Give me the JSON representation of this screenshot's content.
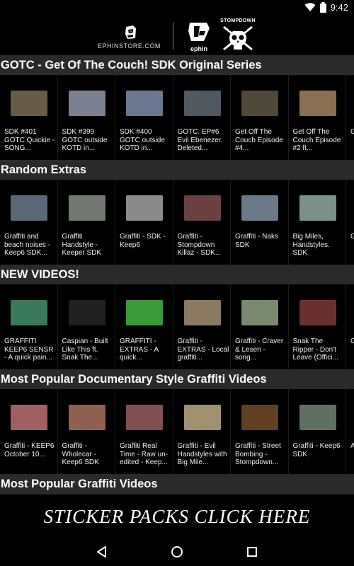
{
  "status": {
    "time": "9:42"
  },
  "header": {
    "store_logo_text": "EPHINSTORE.COM",
    "ephin_logo_text": "ephin",
    "stompdown_logo_text": "STOMPDOWN"
  },
  "sections": [
    {
      "title": "GOTC - Get Of The Couch! SDK Original Series",
      "items": [
        {
          "title": "SDK #401 GOTC Quickie - SONG...",
          "thumb_color": "#6a5a4a"
        },
        {
          "title": "SDK #399 GOTC outside KOTD in...",
          "thumb_color": "#7a8090"
        },
        {
          "title": "SDK #400 GOTC outside KOTD in...",
          "thumb_color": "#6a7890"
        },
        {
          "title": "GOTC. EP#6 Evil Ebenezer. Deleted...",
          "thumb_color": "#505860"
        },
        {
          "title": "Get Off The Couch Episode #4...",
          "thumb_color": "#504838"
        },
        {
          "title": "Get Off The Couch Episode #2 ft...",
          "thumb_color": "#8a7050"
        },
        {
          "title": "G",
          "thumb_color": "#444"
        }
      ]
    },
    {
      "title": "Random Extras",
      "items": [
        {
          "title": "Graffiti and beach noises - Keep6 SDK...",
          "thumb_color": "#5a6878"
        },
        {
          "title": "Graffiti Handstyle - Keeper SDK",
          "thumb_color": "#707870"
        },
        {
          "title": "Graffiti - SDK - Keep6",
          "thumb_color": "#8a8a88"
        },
        {
          "title": "Graffiti - Stompdown Killaz - SDK...",
          "thumb_color": "#6a4040"
        },
        {
          "title": "Graffiti - Naks SDK",
          "thumb_color": "#6a7a8a"
        },
        {
          "title": "Big Miles, Handstyles. SDK",
          "thumb_color": "#7a9088"
        },
        {
          "title": "G",
          "thumb_color": "#444"
        }
      ]
    },
    {
      "title": "NEW VIDEOS!",
      "items": [
        {
          "title": "GRAFFITI KEEP6 SENSR - A quick pain...",
          "thumb_color": "#3a7a5a"
        },
        {
          "title": "Caspian - Built Like This ft. Snak The...",
          "thumb_color": "#202020"
        },
        {
          "title": "GRAFFITI - EXTRAS - A quick...",
          "thumb_color": "#3a9a3a"
        },
        {
          "title": "Graffiti - EXTRAS - Local graffiti...",
          "thumb_color": "#8a7a60"
        },
        {
          "title": "Graffiti - Craver & Lesen - song...",
          "thumb_color": "#7a8a70"
        },
        {
          "title": "Snak The Ripper - Don't Leave (Offici...",
          "thumb_color": "#6a3030"
        },
        {
          "title": "G",
          "thumb_color": "#444"
        }
      ]
    },
    {
      "title": "Most Popular Documentary Style Graffiti Videos",
      "items": [
        {
          "title": "Graffiti - KEEP6 October 10...",
          "thumb_color": "#a06060"
        },
        {
          "title": "Graffiti - Wholecar - Keep6 SDK",
          "thumb_color": "#906050"
        },
        {
          "title": "Graffiti Real Time - Raw un-edited - Keep...",
          "thumb_color": "#805050"
        },
        {
          "title": "Graffiti - Evil Handstyles with Big Mile...",
          "thumb_color": "#a09070"
        },
        {
          "title": "Graffiti - Street Bombing - Stompdown...",
          "thumb_color": "#604020"
        },
        {
          "title": "Graffiti - Keep6 SDK",
          "thumb_color": "#607060"
        },
        {
          "title": "A S",
          "thumb_color": "#444"
        }
      ]
    },
    {
      "title": "Most Popular Graffiti Videos",
      "items": []
    }
  ],
  "banner": {
    "label": "STICKER PACKS CLICK HERE"
  },
  "nav": {
    "back": "back",
    "home": "home",
    "recents": "recents"
  }
}
